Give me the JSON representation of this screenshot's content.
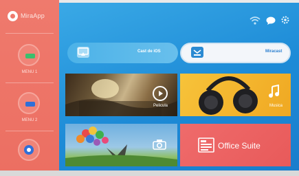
{
  "sidebar": {
    "logo_text": "MiraApp",
    "items": [
      {
        "label": "MENU 1",
        "icon": "green-pill-icon",
        "color": "#3cbf6d"
      },
      {
        "label": "MENU 2",
        "icon": "blue-pill-icon",
        "color": "#2f6fd8"
      },
      {
        "label": "",
        "icon": "settings-icon",
        "color": "#2f6fd8"
      }
    ]
  },
  "header": {
    "icons": [
      "wifi-icon",
      "chat-bubble-icon",
      "settings-icon"
    ]
  },
  "main": {
    "cast_ios": {
      "label": "Cast de iOS",
      "icon": "screen-cast-icon"
    },
    "miracast": {
      "label": "Miracast",
      "icon": "miracast-icon"
    },
    "tiles": {
      "pelicula": {
        "label": "Pelicula",
        "icon": "play-icon"
      },
      "musica": {
        "label": "Musica",
        "icon": "music-note-icon"
      },
      "photo": {
        "label": "",
        "icon": "camera-icon"
      },
      "office": {
        "label": "Office Suite",
        "icon": "document-icon"
      }
    }
  },
  "colors": {
    "sidebar": "#ec6f62",
    "main_bg": "#1d8bd7",
    "cast_ios_bg": "#5ab8ea",
    "miracast_bg": "#f3f6fa",
    "musica_bg": "#f3b32c",
    "office_bg": "#e85a5a"
  }
}
